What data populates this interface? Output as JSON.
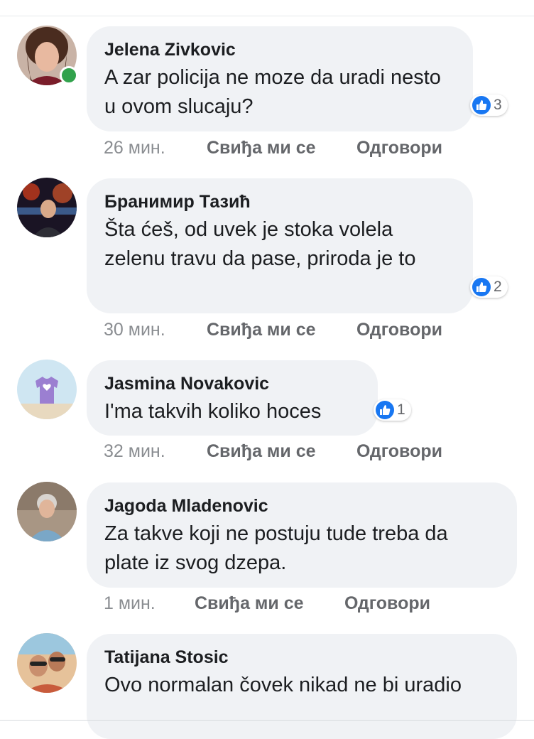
{
  "comments": [
    {
      "author": "Jelena Zivkovic",
      "text": "A zar policija ne moze da uradi nesto u ovom slucaju?",
      "likes": "3",
      "time": "26 мин.",
      "like_label": "Свиђа ми се",
      "reply_label": "Одговори",
      "online": true
    },
    {
      "author": "Бранимир Тазић",
      "text": "Šta ćeš, od uvek je stoka volela zelenu travu da pase, priroda je to",
      "likes": "2",
      "time": "30 мин.",
      "like_label": "Свиђа ми се",
      "reply_label": "Одговори"
    },
    {
      "author": "Jasmina Novakovic",
      "text": "I'ma takvih koliko hoces",
      "likes": "1",
      "time": "32 мин.",
      "like_label": "Свиђа ми се",
      "reply_label": "Одговори"
    },
    {
      "author": "Jagoda Mladenovic",
      "text": "Za takve koji ne postuju tude treba da plate iz svog dzepa.",
      "time": "1 мин.",
      "like_label": "Свиђа ми се",
      "reply_label": "Одговори"
    },
    {
      "author": "Tatijana Stosic",
      "text": "Ovo normalan čovek nikad ne bi uradio"
    }
  ],
  "colors": {
    "bubble": "#f0f2f5",
    "like_blue": "#1877f2",
    "online_green": "#31a24c",
    "meta_gray": "#65676b"
  },
  "icons": {
    "reaction": "thumbs-up-icon"
  }
}
